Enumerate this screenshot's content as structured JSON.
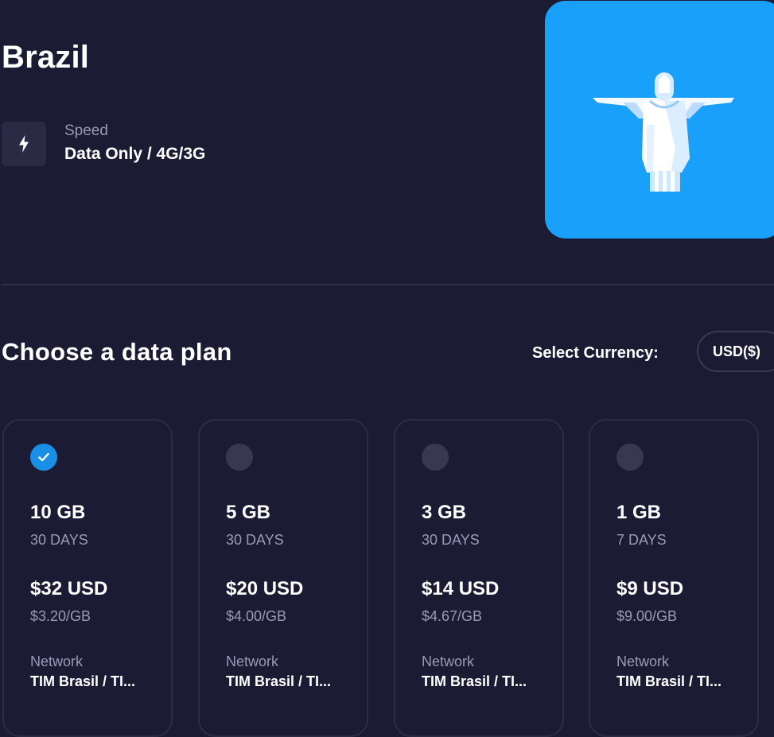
{
  "country": {
    "title": "Brazil",
    "image_icon": "christ-the-redeemer-icon",
    "image_bg_color": "#18a0fb"
  },
  "speed": {
    "icon": "lightning-icon",
    "label": "Speed",
    "value": "Data Only / 4G/3G"
  },
  "plans_section": {
    "title": "Choose a data plan",
    "currency_label": "Select Currency:",
    "currency_value": "USD($)"
  },
  "plans": [
    {
      "selected": true,
      "data": "10 GB",
      "duration": "30 DAYS",
      "price": "$32 USD",
      "price_per_gb": "$3.20/GB",
      "network_label": "Network",
      "network": "TIM Brasil / TI..."
    },
    {
      "selected": false,
      "data": "5 GB",
      "duration": "30 DAYS",
      "price": "$20 USD",
      "price_per_gb": "$4.00/GB",
      "network_label": "Network",
      "network": "TIM Brasil / TI..."
    },
    {
      "selected": false,
      "data": "3 GB",
      "duration": "30 DAYS",
      "price": "$14 USD",
      "price_per_gb": "$4.67/GB",
      "network_label": "Network",
      "network": "TIM Brasil / TI..."
    },
    {
      "selected": false,
      "data": "1 GB",
      "duration": "7 DAYS",
      "price": "$9 USD",
      "price_per_gb": "$9.00/GB",
      "network_label": "Network",
      "network": "TIM Brasil / TI..."
    }
  ],
  "colors": {
    "background": "#1b1b33",
    "accent": "#1a8fe6",
    "muted_text": "#9a9ab8"
  }
}
